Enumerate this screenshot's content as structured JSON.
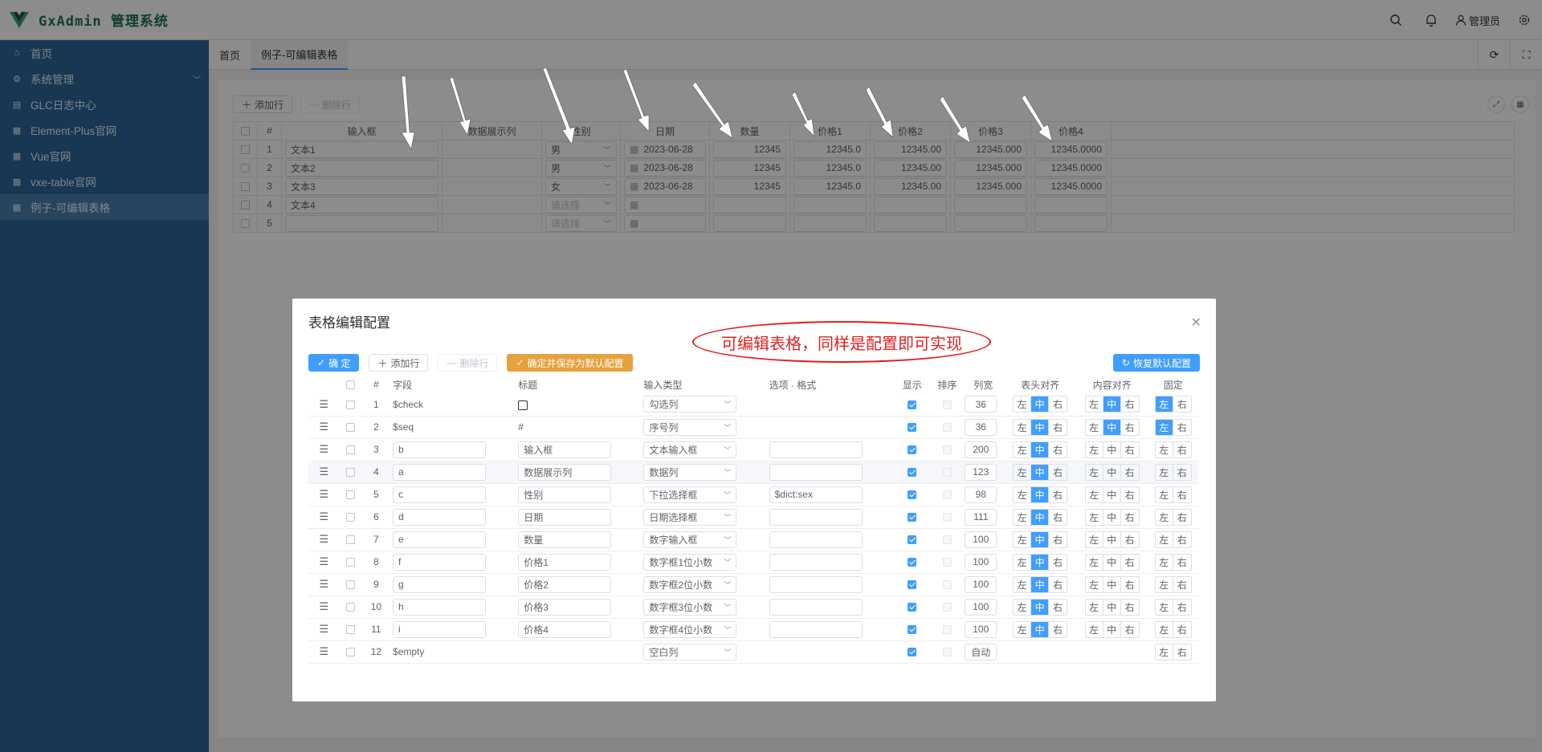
{
  "app": {
    "title": "GxAdmin 管理系统",
    "user": "管理员"
  },
  "sidebar": {
    "items": [
      {
        "label": "首页",
        "icon": "home-icon"
      },
      {
        "label": "系统管理",
        "icon": "gear-icon"
      },
      {
        "label": "GLC日志中心",
        "icon": "document-icon"
      },
      {
        "label": "Element-Plus官网",
        "icon": "grid-icon"
      },
      {
        "label": "Vue官网",
        "icon": "grid-icon"
      },
      {
        "label": "vxe-table官网",
        "icon": "grid-icon"
      },
      {
        "label": "例子-可编辑表格",
        "icon": "grid-icon"
      }
    ]
  },
  "tabs": [
    {
      "label": "首页"
    },
    {
      "label": "例子-可编辑表格"
    }
  ],
  "toolbar": {
    "add": "添加行",
    "del": "删除行"
  },
  "table": {
    "headers": [
      "#",
      "输入框",
      "数据展示列",
      "性别",
      "日期",
      "数量",
      "价格1",
      "价格2",
      "价格3",
      "价格4"
    ],
    "rows": [
      {
        "n": "1",
        "text": "文本1",
        "sex": "男",
        "date": "2023-06-28",
        "qty": "12345",
        "p1": "12345.0",
        "p2": "12345.00",
        "p3": "12345.000",
        "p4": "12345.0000"
      },
      {
        "n": "2",
        "text": "文本2",
        "sex": "男",
        "date": "2023-06-28",
        "qty": "12345",
        "p1": "12345.0",
        "p2": "12345.00",
        "p3": "12345.000",
        "p4": "12345.0000"
      },
      {
        "n": "3",
        "text": "文本3",
        "sex": "女",
        "date": "2023-06-28",
        "qty": "12345",
        "p1": "12345.0",
        "p2": "12345.00",
        "p3": "12345.000",
        "p4": "12345.0000"
      },
      {
        "n": "4",
        "text": "文本4",
        "sex": "请选择",
        "date": "",
        "qty": "",
        "p1": "",
        "p2": "",
        "p3": "",
        "p4": ""
      },
      {
        "n": "5",
        "text": "",
        "sex": "请选择",
        "date": "",
        "qty": "",
        "p1": "",
        "p2": "",
        "p3": "",
        "p4": ""
      }
    ]
  },
  "dialog": {
    "title": "表格编辑配置",
    "ok": "确 定",
    "add": "添加行",
    "del": "删除行",
    "save_default": "确定并保存为默认配置",
    "restore": "恢复默认配置",
    "headers": [
      "#",
      "字段",
      "标题",
      "输入类型",
      "选项 · 格式",
      "显示",
      "排序",
      "列宽",
      "表头对齐",
      "内容对齐",
      "固定"
    ],
    "align": {
      "left": "左",
      "center": "中",
      "right": "右"
    },
    "rows": [
      {
        "n": "1",
        "field": "$check",
        "title": "",
        "type": "勾选列",
        "opt": "",
        "width": "36",
        "fieldInput": false,
        "titleCheckbox": true,
        "headAlign": "center",
        "contentAlign": "center",
        "fix": "left",
        "optInput": false
      },
      {
        "n": "2",
        "field": "$seq",
        "title": "#",
        "type": "序号列",
        "opt": "",
        "width": "36",
        "fieldInput": false,
        "titleCheckbox": false,
        "headAlign": "center",
        "contentAlign": "center",
        "fix": "left",
        "optInput": false
      },
      {
        "n": "3",
        "field": "b",
        "title": "输入框",
        "type": "文本输入框",
        "opt": "",
        "width": "200",
        "fieldInput": true,
        "headAlign": "center",
        "contentAlign": "none",
        "fix": "none",
        "optInput": true
      },
      {
        "n": "4",
        "field": "a",
        "title": "数据展示列",
        "type": "数据列",
        "opt": "",
        "width": "123",
        "fieldInput": true,
        "headAlign": "center",
        "contentAlign": "none",
        "fix": "none",
        "optInput": true
      },
      {
        "n": "5",
        "field": "c",
        "title": "性别",
        "type": "下拉选择框",
        "opt": "$dict:sex",
        "width": "98",
        "fieldInput": true,
        "headAlign": "center",
        "contentAlign": "none",
        "fix": "none",
        "optInput": true
      },
      {
        "n": "6",
        "field": "d",
        "title": "日期",
        "type": "日期选择框",
        "opt": "",
        "width": "111",
        "fieldInput": true,
        "headAlign": "center",
        "contentAlign": "none",
        "fix": "none",
        "optInput": true
      },
      {
        "n": "7",
        "field": "e",
        "title": "数量",
        "type": "数字输入框",
        "opt": "",
        "width": "100",
        "fieldInput": true,
        "headAlign": "center",
        "contentAlign": "none",
        "fix": "none",
        "optInput": true
      },
      {
        "n": "8",
        "field": "f",
        "title": "价格1",
        "type": "数字框1位小数",
        "opt": "",
        "width": "100",
        "fieldInput": true,
        "headAlign": "center",
        "contentAlign": "none",
        "fix": "none",
        "optInput": true
      },
      {
        "n": "9",
        "field": "g",
        "title": "价格2",
        "type": "数字框2位小数",
        "opt": "",
        "width": "100",
        "fieldInput": true,
        "headAlign": "center",
        "contentAlign": "none",
        "fix": "none",
        "optInput": true
      },
      {
        "n": "10",
        "field": "h",
        "title": "价格3",
        "type": "数字框3位小数",
        "opt": "",
        "width": "100",
        "fieldInput": true,
        "headAlign": "center",
        "contentAlign": "none",
        "fix": "none",
        "optInput": true
      },
      {
        "n": "11",
        "field": "i",
        "title": "价格4",
        "type": "数字框4位小数",
        "opt": "",
        "width": "100",
        "fieldInput": true,
        "headAlign": "center",
        "contentAlign": "none",
        "fix": "none",
        "optInput": true
      },
      {
        "n": "12",
        "field": "$empty",
        "title": "",
        "type": "空白列",
        "opt": "",
        "width": "自动",
        "fieldInput": false,
        "headAlign": "hidden",
        "contentAlign": "hidden",
        "fix": "none",
        "optInput": false
      }
    ]
  },
  "annotation": "可编辑表格，同样是配置即可实现",
  "colors": {
    "primary": "#409eff",
    "sidebar": "#2a6496",
    "warning": "#e6a23c",
    "annotation": "#e02020"
  }
}
